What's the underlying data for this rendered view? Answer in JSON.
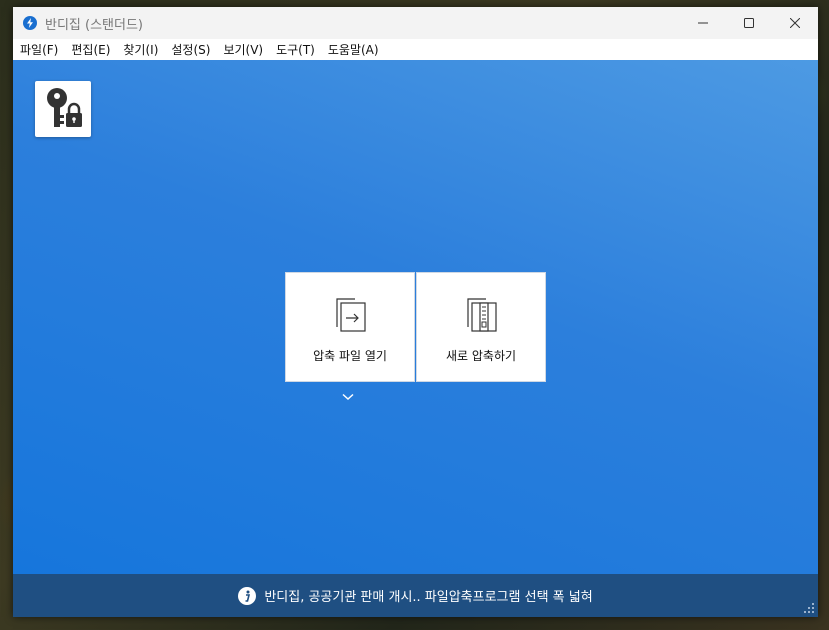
{
  "window": {
    "title": "반디집 (스탠더드)",
    "app_icon": "bandizip-bolt-icon",
    "controls": [
      "minimize-icon",
      "maximize-icon",
      "close-icon"
    ]
  },
  "menu": {
    "items": [
      {
        "label": "파일(F)"
      },
      {
        "label": "편집(E)"
      },
      {
        "label": "찾기(I)"
      },
      {
        "label": "설정(S)"
      },
      {
        "label": "보기(V)"
      },
      {
        "label": "도구(T)"
      },
      {
        "label": "도움말(A)"
      }
    ]
  },
  "toolbar": {
    "key_icon": "key-lock-icon"
  },
  "tiles": {
    "open": {
      "label": "압축 파일 열기",
      "icon": "open-archive-icon"
    },
    "new": {
      "label": "새로 압축하기",
      "icon": "new-archive-icon"
    },
    "dropdown_icon": "chevron-down-icon"
  },
  "status": {
    "text": "반디집, 공공기관 판매 개시.. 파일압축프로그램 선택 폭 넓혀",
    "icon": "info-icon"
  },
  "colors": {
    "accent": "#1676dc",
    "status_bg": "#1f4f82"
  }
}
